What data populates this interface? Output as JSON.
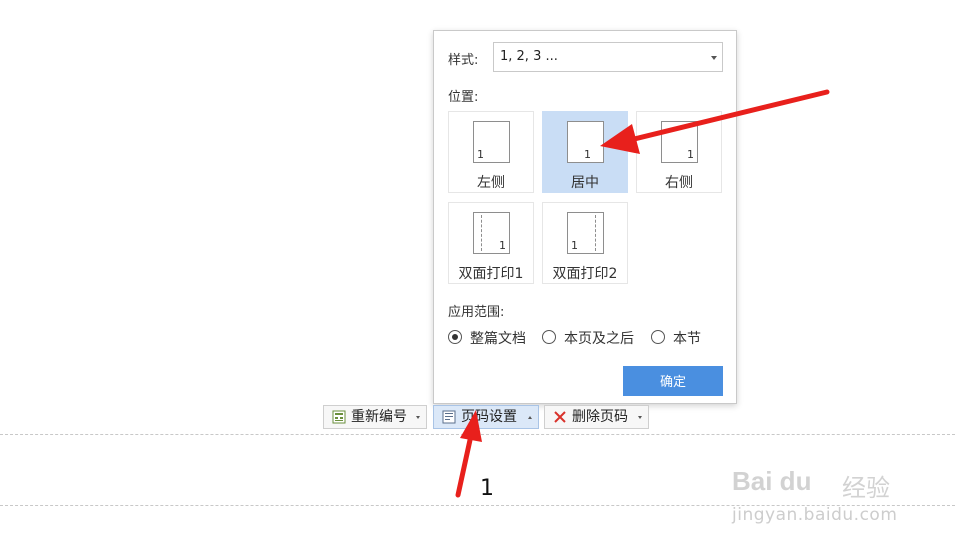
{
  "popup": {
    "style_label": "样式:",
    "style_value": "1, 2, 3 ...",
    "position_label": "位置:",
    "positions": [
      {
        "label": "左侧",
        "num": "1",
        "selected": false
      },
      {
        "label": "居中",
        "num": "1",
        "selected": true
      },
      {
        "label": "右侧",
        "num": "1",
        "selected": false
      },
      {
        "label": "双面打印1",
        "num": "1",
        "selected": false
      },
      {
        "label": "双面打印2",
        "num": "1",
        "selected": false
      }
    ],
    "scope_label": "应用范围:",
    "scope_options": [
      {
        "label": "整篇文档",
        "checked": true
      },
      {
        "label": "本页及之后",
        "checked": false
      },
      {
        "label": "本节",
        "checked": false
      }
    ],
    "ok_label": "确定"
  },
  "toolbar": {
    "renumber_label": "重新编号",
    "page_settings_label": "页码设置",
    "delete_label": "删除页码"
  },
  "annotation": {
    "step_number": "1",
    "arrow_color": "#e8201c"
  },
  "watermark": {
    "brand": "Bai du",
    "brand_cn": "经验",
    "url": "jingyan.baidu.com"
  },
  "colors": {
    "selected_bg": "#c9ddf5",
    "ok_button": "#4a8fe0"
  }
}
